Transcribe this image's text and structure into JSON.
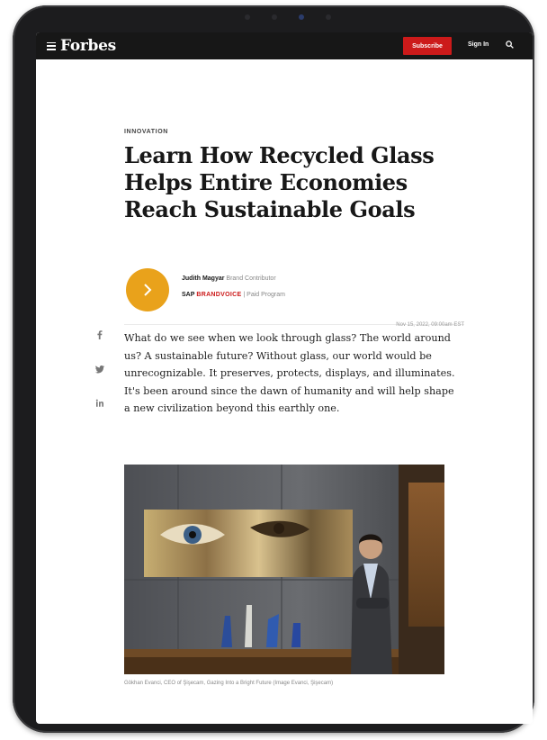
{
  "header": {
    "logo": "Forbes",
    "subscribe_label": "Subscribe",
    "signin_label": "Sign In",
    "menu_icon": "hamburger-menu-icon",
    "search_icon": "search-icon"
  },
  "article": {
    "section": "INNOVATION",
    "headline": "Learn How Recycled Glass Helps Entire Economies Reach Sustainable Goals",
    "author": {
      "name": "Judith Magyar",
      "role": "Brand Contributor",
      "avatar_icon": "chevron-right-icon",
      "avatar_color": "#e9a21b"
    },
    "brand": {
      "sponsor": "SAP",
      "voice": "BRANDVOICE",
      "separator": "|",
      "program": "Paid Program"
    },
    "timestamp": "Nov 15, 2022, 09:00am EST",
    "share_icons": [
      "facebook-icon",
      "twitter-icon",
      "linkedin-icon"
    ],
    "body": "What do we see when we look through glass? The world around us? A sustainable future? Without glass, our world would be unrecognizable. It preserves, protects, displays, and illuminates. It's been around since the dawn of humanity and will help shape a new civilization beyond this earthly one.",
    "image_caption": "Gökhan Evanci, CEO of Şişecam, Gazing Into a Bright Future  (Image Evanci, Şişecam)"
  },
  "colors": {
    "accent_red": "#cc1a1a",
    "header_bg": "#171717",
    "avatar_gold": "#e9a21b"
  }
}
